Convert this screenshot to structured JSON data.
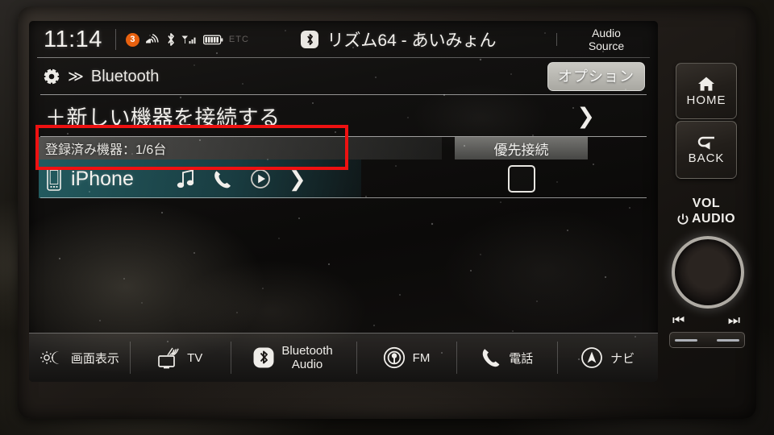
{
  "status_bar": {
    "clock": "11:14",
    "notification_count": "3",
    "etc_label": "ETC",
    "icons": [
      "notification-badge-icon",
      "wifi-antenna-icon",
      "bluetooth-icon",
      "cellular-signal-icon",
      "battery-icon"
    ],
    "now_playing": "リズム64 - あいみょん",
    "now_playing_source_icon": "bluetooth-icon",
    "audio_source_line1": "Audio",
    "audio_source_line2": "Source"
  },
  "header": {
    "gear_icon": "gear-icon",
    "chevron": "≫",
    "breadcrumb": "Bluetooth",
    "options_label": "オプション"
  },
  "add_device": {
    "label": "＋新しい機器を接続する",
    "chevron": "❯",
    "annotation_color": "#ee1111"
  },
  "registered": {
    "count_label": "登録済み機器：1/6台",
    "priority_header": "優先接続"
  },
  "device": {
    "icon": "smartphone-icon",
    "name": "iPhone",
    "actions": [
      "music-note-icon",
      "phone-handset-icon",
      "play-circle-icon",
      "chevron-right-icon"
    ],
    "priority_checked": false
  },
  "source_bar": {
    "items": [
      {
        "icon": "brightness-day-night-icon",
        "label": "画面表示",
        "label2": ""
      },
      {
        "icon": "tv-antenna-icon",
        "label": "TV",
        "label2": ""
      },
      {
        "icon": "bluetooth-icon",
        "label": "Bluetooth",
        "label2": "Audio"
      },
      {
        "icon": "radio-tower-icon",
        "label": "FM",
        "label2": ""
      },
      {
        "icon": "phone-handset-icon",
        "label": "電話",
        "label2": ""
      },
      {
        "icon": "navigation-compass-icon",
        "label": "ナビ",
        "label2": ""
      }
    ]
  },
  "hard_keys": {
    "home_label": "HOME",
    "back_label": "BACK",
    "vol_line1": "VOL",
    "vol_line2": "AUDIO",
    "prev_track": "⏮",
    "next_track": "⏭"
  },
  "colors": {
    "accent_orange": "#e8610f",
    "annotation_red": "#ee1111",
    "row_highlight_teal": "#245f64",
    "screen_text": "#f2f0ec"
  }
}
